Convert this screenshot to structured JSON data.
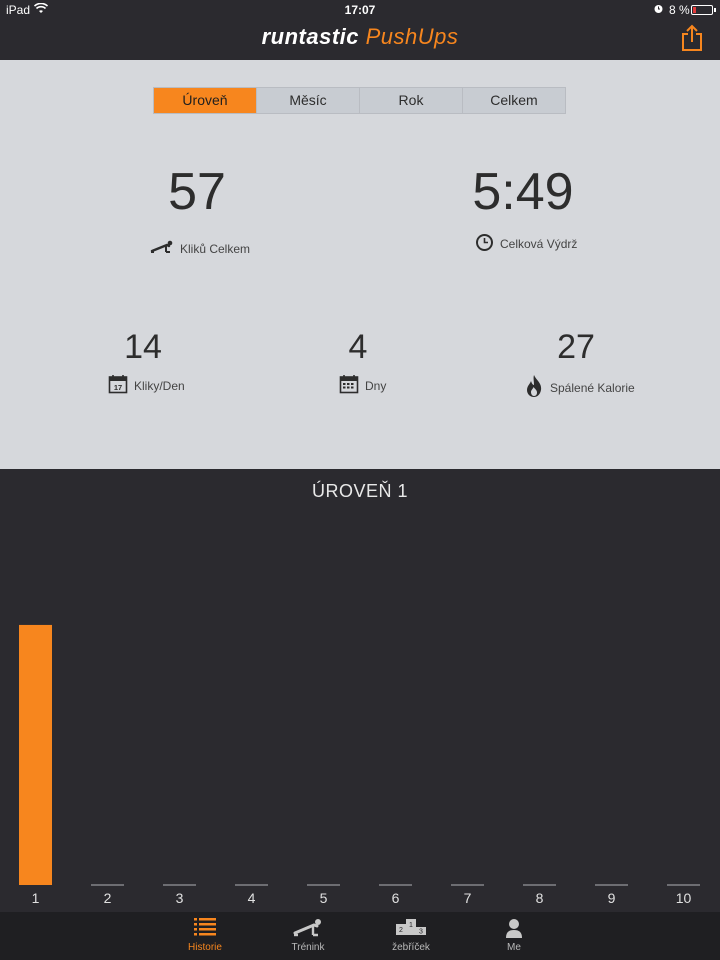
{
  "status_bar": {
    "carrier": "iPad",
    "time": "17:07",
    "battery": "8 %"
  },
  "brand": {
    "part1": "runtastic",
    "part2": "PushUps"
  },
  "segments": [
    "Úroveň",
    "Měsíc",
    "Rok",
    "Celkem"
  ],
  "active_segment": "Úroveň",
  "stats": {
    "total_pushups": {
      "value": "57",
      "label": "Kliků Celkem",
      "icon": "pushup-icon"
    },
    "total_endurance": {
      "value": "5:49",
      "label": "Celková Výdrž",
      "icon": "clock-icon"
    },
    "per_day": {
      "value": "14",
      "label": "Kliky/Den",
      "icon": "calendar-icon",
      "icon_text": "17"
    },
    "days": {
      "value": "4",
      "label": "Dny",
      "icon": "calendar-grid-icon"
    },
    "calories": {
      "value": "27",
      "label": "Spálené Kalorie",
      "icon": "flame-icon"
    }
  },
  "colors": {
    "accent": "#f7861e",
    "dark": "#2b2a2f",
    "panel": "#d6d8dc"
  },
  "chart_data": {
    "type": "bar",
    "title": "ÚROVEŇ 1",
    "categories": [
      "1",
      "2",
      "3",
      "4",
      "5",
      "6",
      "7",
      "8",
      "9",
      "10"
    ],
    "values": [
      57,
      0,
      0,
      0,
      0,
      0,
      0,
      0,
      0,
      0
    ],
    "ylim": [
      0,
      80
    ],
    "grid": false,
    "color": "#f7861e"
  },
  "tabs": [
    {
      "label": "Historie",
      "icon": "list-icon",
      "active": true
    },
    {
      "label": "Trénink",
      "icon": "pushup-icon",
      "active": false
    },
    {
      "label": "žebříček",
      "icon": "podium-icon",
      "active": false
    },
    {
      "label": "Me",
      "icon": "user-icon",
      "active": false
    }
  ]
}
